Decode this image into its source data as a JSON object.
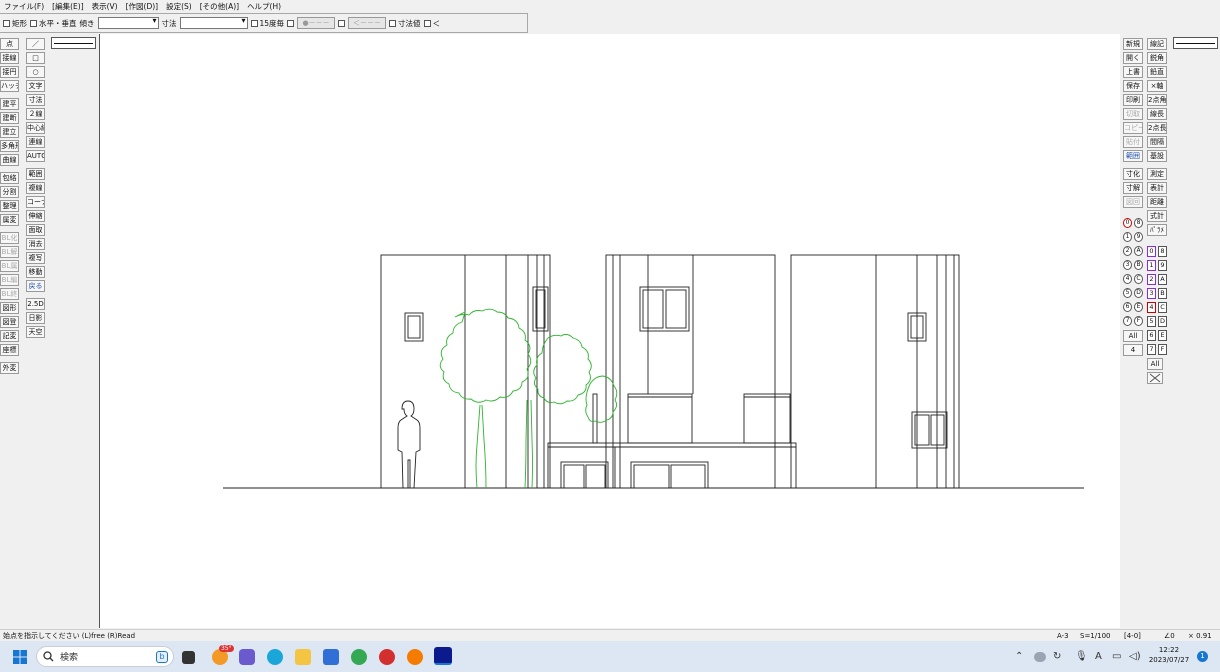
{
  "menu": [
    "ファイル(F)",
    "[編集(E)]",
    "表示(V)",
    "[作図(D)]",
    "設定(S)",
    "[その他(A)]",
    "ヘルプ(H)"
  ],
  "options": {
    "rect_label": "矩形",
    "hv_label": "水平・垂直",
    "slope_label": "傾き",
    "dim_label": "寸法",
    "deg15_label": "15度毎",
    "circle_field": "●－－－",
    "arrow_field": "＜－－－",
    "dimval_label": "寸法値",
    "lt_label": "＜"
  },
  "left_tools_1": [
    "点",
    "接線",
    "接円",
    "ハッチ",
    "建平",
    "建断",
    "建立",
    "多角形",
    "曲線",
    "包絡",
    "分割",
    "整理",
    "属変",
    "BL化",
    "BL解",
    "BL属",
    "BL編",
    "BL終",
    "図形",
    "図登",
    "記変",
    "座標",
    "外変"
  ],
  "left_tools_2": [
    "／",
    "□",
    "○",
    "文字",
    "寸法",
    "２線",
    "中心線",
    "連線",
    "AUTO",
    "範囲",
    "複線",
    "コーナー",
    "伸縮",
    "面取",
    "消去",
    "複写",
    "移動",
    "戻る",
    "2.5D",
    "日影",
    "天空"
  ],
  "right_tools_1": [
    "新規",
    "開く",
    "上書",
    "保存",
    "印刷",
    "切取",
    "コピー",
    "貼付",
    "範囲",
    "寸化",
    "寸解",
    "図回"
  ],
  "right_tools_2": [
    "線記",
    "鋭角",
    "鉛直",
    "×軸",
    "2点角",
    "線長",
    "2点長",
    "間隔",
    "基設",
    "測定",
    "表計",
    "距離",
    "式計",
    "ﾊﾟﾗﾒ"
  ],
  "layer_groups": [
    "0",
    "1",
    "2",
    "3",
    "4",
    "5",
    "6",
    "7",
    "8",
    "9",
    "A",
    "B",
    "C",
    "D",
    "E",
    "F"
  ],
  "layers": [
    "0",
    "1",
    "2",
    "3",
    "4",
    "5",
    "6",
    "7",
    "8",
    "9",
    "A",
    "B",
    "C",
    "D",
    "E",
    "F"
  ],
  "layer_all": "All",
  "layer_current": "4",
  "status": {
    "message": "始点を指示してください (L)free (R)Read",
    "sheet": "A-3",
    "scale": "S=1/100",
    "layer": "[4-0]",
    "angle": "∠0",
    "factor": "× 0.91"
  },
  "taskbar": {
    "search_placeholder": "検索",
    "weather": "35°",
    "time": "12:22",
    "date": "2023/07/27",
    "notifications": "1"
  },
  "colors": {
    "tree": "#2db52d",
    "drawing": "#222222",
    "taskbar": "#dde6f3"
  }
}
